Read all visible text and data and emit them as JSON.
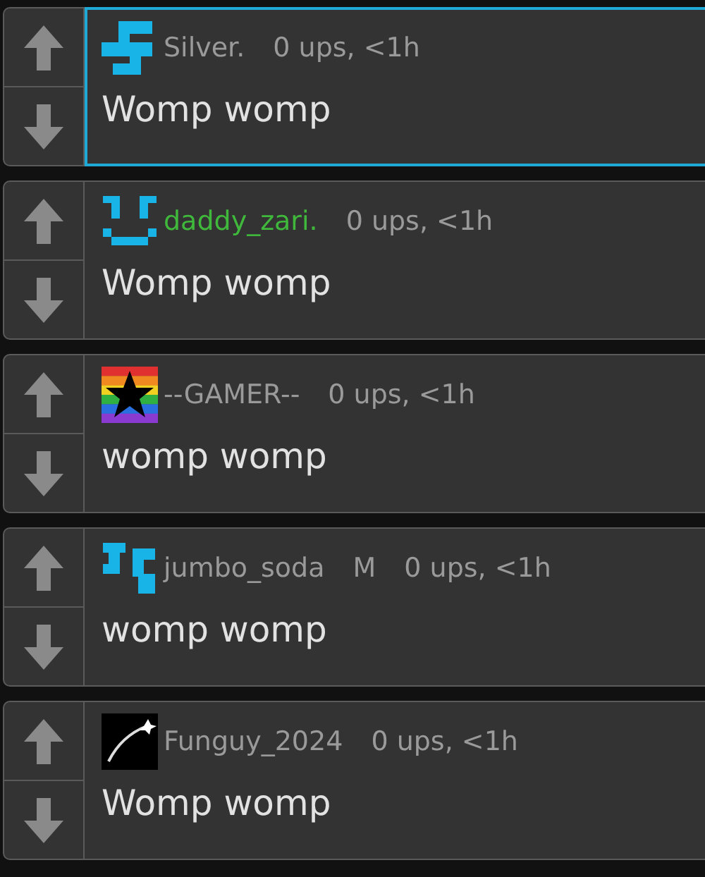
{
  "comments": [
    {
      "avatar": {
        "kind": "s-logo"
      },
      "name": "Silver.",
      "color": "#9a9a9a",
      "meta": "0 ups, <1h",
      "message": "Womp womp",
      "selected": true
    },
    {
      "avatar": {
        "kind": "face"
      },
      "name": "daddy_zari.",
      "color": "#3fb83c",
      "meta": "0 ups, <1h",
      "message": "Womp womp",
      "selected": false
    },
    {
      "avatar": {
        "kind": "rainbow-star"
      },
      "name": "--GAMER--",
      "color": "#9a9a9a",
      "meta": "0 ups, <1h",
      "message": "womp womp",
      "selected": false
    },
    {
      "avatar": {
        "kind": "tiles"
      },
      "name": "jumbo_soda",
      "color": "#9a9a9a",
      "badge": "M",
      "meta": "0 ups, <1h",
      "message": "womp womp",
      "selected": false
    },
    {
      "avatar": {
        "kind": "comet"
      },
      "name": "Funguy_2024",
      "color": "#9a9a9a",
      "meta": "0 ups, <1h",
      "message": "Womp womp",
      "selected": false
    }
  ]
}
